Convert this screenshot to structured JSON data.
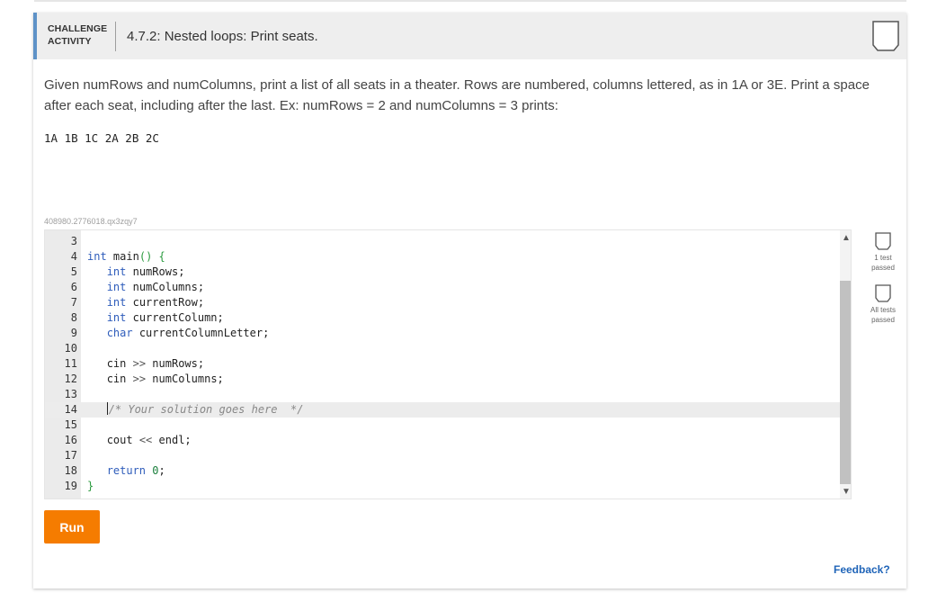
{
  "header": {
    "activity_type_line1": "CHALLENGE",
    "activity_type_line2": "ACTIVITY",
    "title": "4.7.2: Nested loops: Print seats."
  },
  "prompt": {
    "text": "Given numRows and numColumns, print a list of all seats in a theater. Rows are numbered, columns lettered, as in 1A or 3E. Print a space after each seat, including after the last. Ex: numRows = 2 and numColumns = 3 prints:",
    "example_output": "1A 1B 1C 2A 2B 2C"
  },
  "activity_id": "408980.2776018.qx3zqy7",
  "editor": {
    "lines": [
      {
        "no": "3",
        "code": ""
      },
      {
        "no": "4",
        "code": "int main() {"
      },
      {
        "no": "5",
        "code": "   int numRows;"
      },
      {
        "no": "6",
        "code": "   int numColumns;"
      },
      {
        "no": "7",
        "code": "   int currentRow;"
      },
      {
        "no": "8",
        "code": "   int currentColumn;"
      },
      {
        "no": "9",
        "code": "   char currentColumnLetter;"
      },
      {
        "no": "10",
        "code": ""
      },
      {
        "no": "11",
        "code": "   cin >> numRows;"
      },
      {
        "no": "12",
        "code": "   cin >> numColumns;"
      },
      {
        "no": "13",
        "code": ""
      },
      {
        "no": "14",
        "code": "   /* Your solution goes here  */"
      },
      {
        "no": "15",
        "code": ""
      },
      {
        "no": "16",
        "code": "   cout << endl;"
      },
      {
        "no": "17",
        "code": ""
      },
      {
        "no": "18",
        "code": "   return 0;"
      },
      {
        "no": "19",
        "code": "}"
      }
    ],
    "active_line": "14"
  },
  "tests": [
    {
      "label_line1": "1 test",
      "label_line2": "passed"
    },
    {
      "label_line1": "All tests",
      "label_line2": "passed"
    }
  ],
  "run_label": "Run",
  "feedback_label": "Feedback?",
  "colors": {
    "accent": "#5e92c7",
    "run_button": "#f57c00",
    "link": "#1f64b8"
  },
  "icons": [
    "completion-checkbox-icon",
    "test-checkbox-icon",
    "chevron-up-icon",
    "chevron-down-icon"
  ]
}
